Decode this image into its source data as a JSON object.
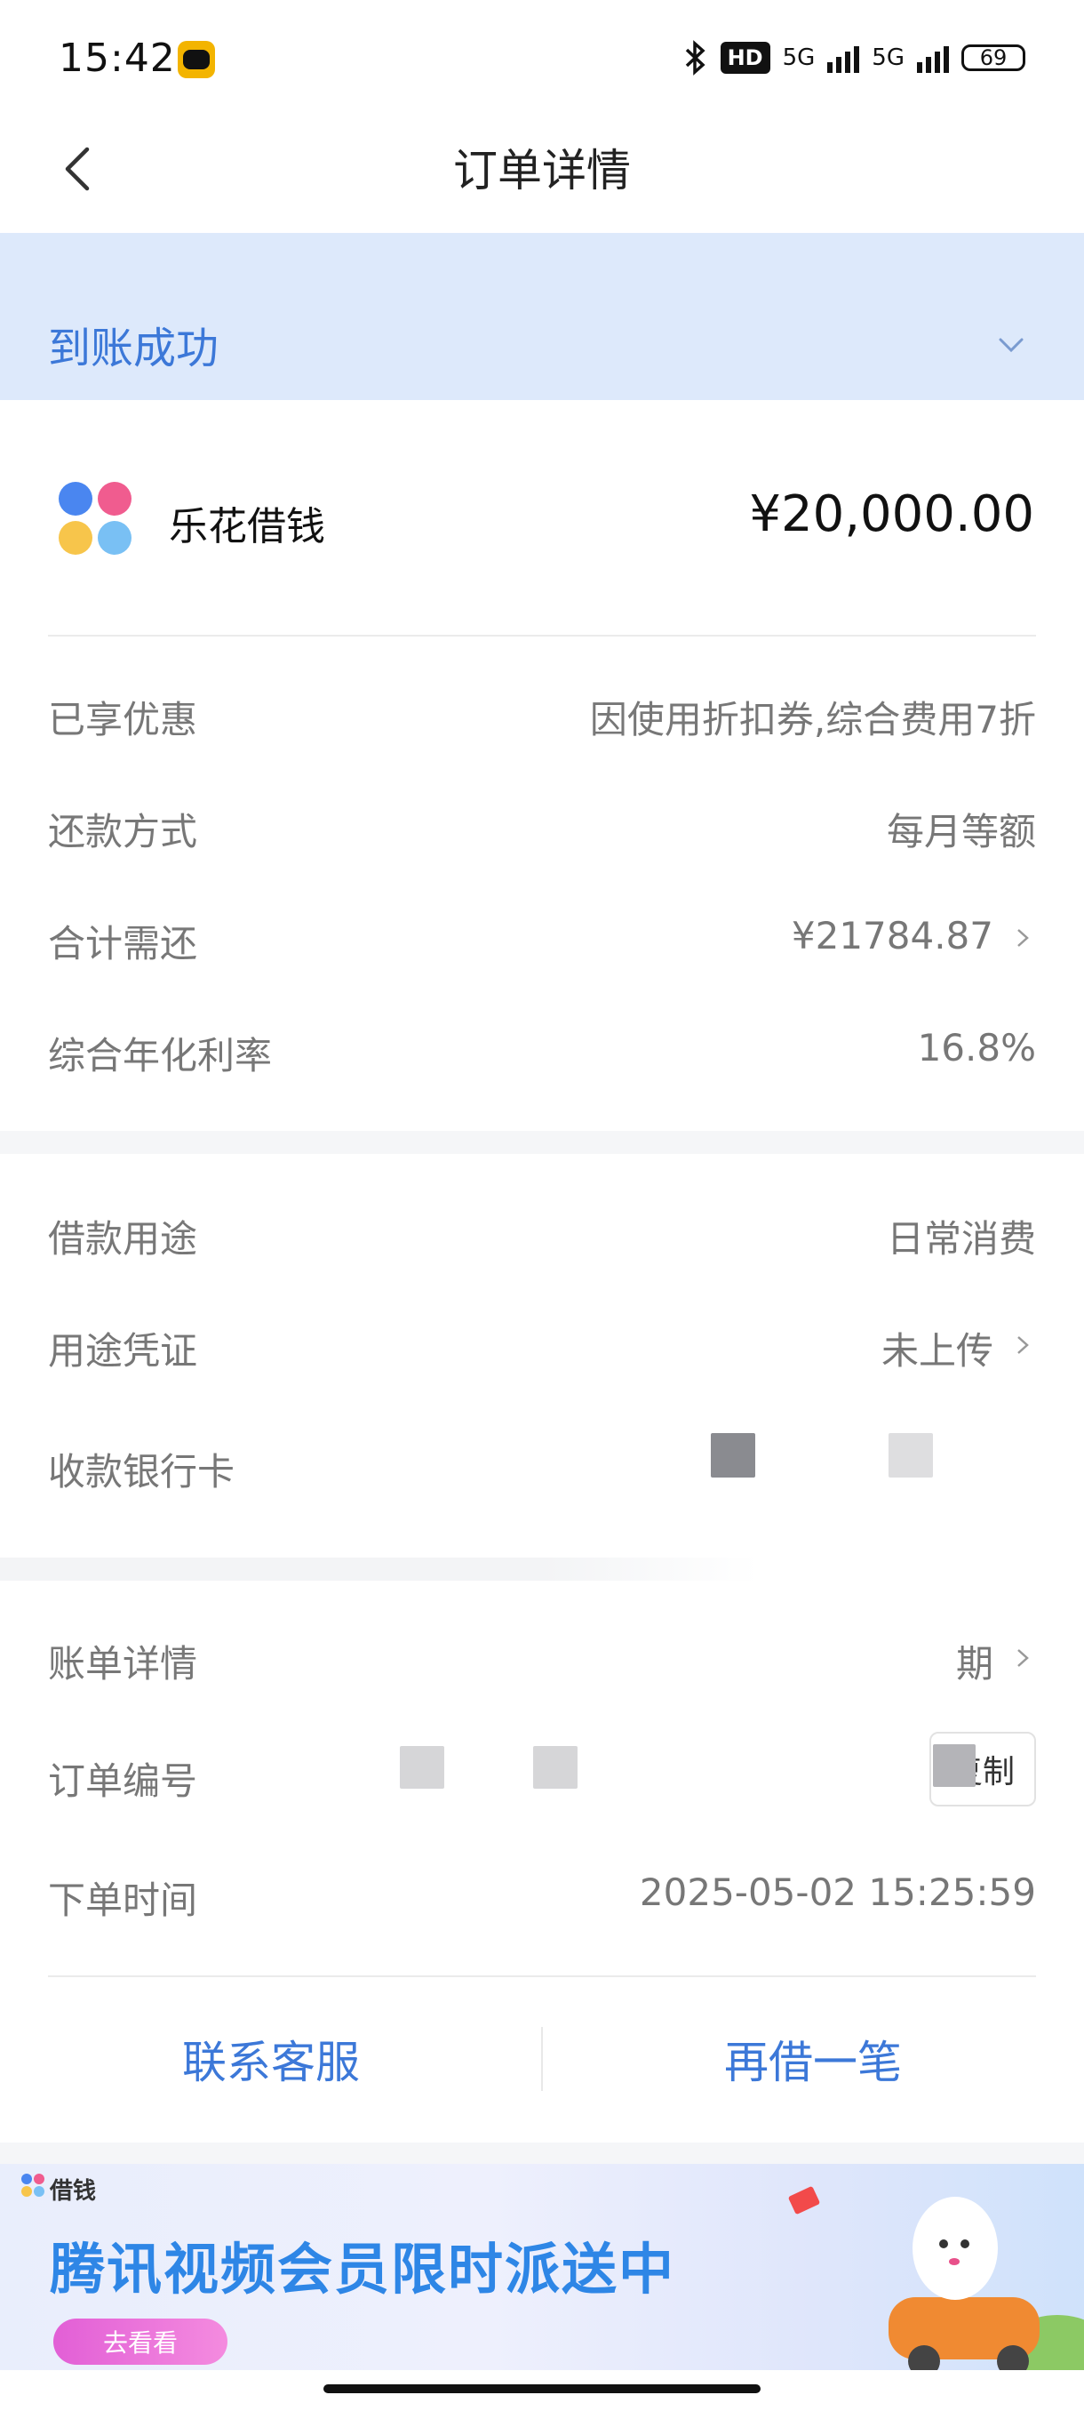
{
  "status_bar": {
    "time": "15:42",
    "network_badge": "HD",
    "signal1": "5G",
    "signal2": "5G",
    "battery": "69"
  },
  "header": {
    "title": "订单详情"
  },
  "status_banner": {
    "text": "到账成功"
  },
  "product": {
    "name": "乐花借钱",
    "amount": "¥20,000.00"
  },
  "details_1": [
    {
      "label": "已享优惠",
      "value": "因使用折扣券,综合费用7折"
    },
    {
      "label": "还款方式",
      "value": "每月等额"
    },
    {
      "label": "合计需还",
      "value": "¥21784.87"
    },
    {
      "label": "综合年化利率",
      "value": "16.8%"
    }
  ],
  "details_2": [
    {
      "label": "借款用途",
      "value": "日常消费"
    },
    {
      "label": "用途凭证",
      "value": "未上传"
    },
    {
      "label": "收款银行卡",
      "value": ""
    }
  ],
  "details_3": [
    {
      "label": "账单详情",
      "value": "期"
    },
    {
      "label": "订单编号",
      "value": "",
      "copy_label": "复制"
    },
    {
      "label": "下单时间",
      "value": "2025-05-02 15:25:59"
    }
  ],
  "actions": {
    "contact": "联系客服",
    "borrow_again": "再借一笔"
  },
  "ad": {
    "brand": "借钱",
    "title": "腾讯视频会员限时派送中",
    "button": "去看看"
  },
  "colors": {
    "accent": "#3c78d8",
    "banner_bg": "#dde9fb",
    "ad_title": "#2e86e6"
  }
}
